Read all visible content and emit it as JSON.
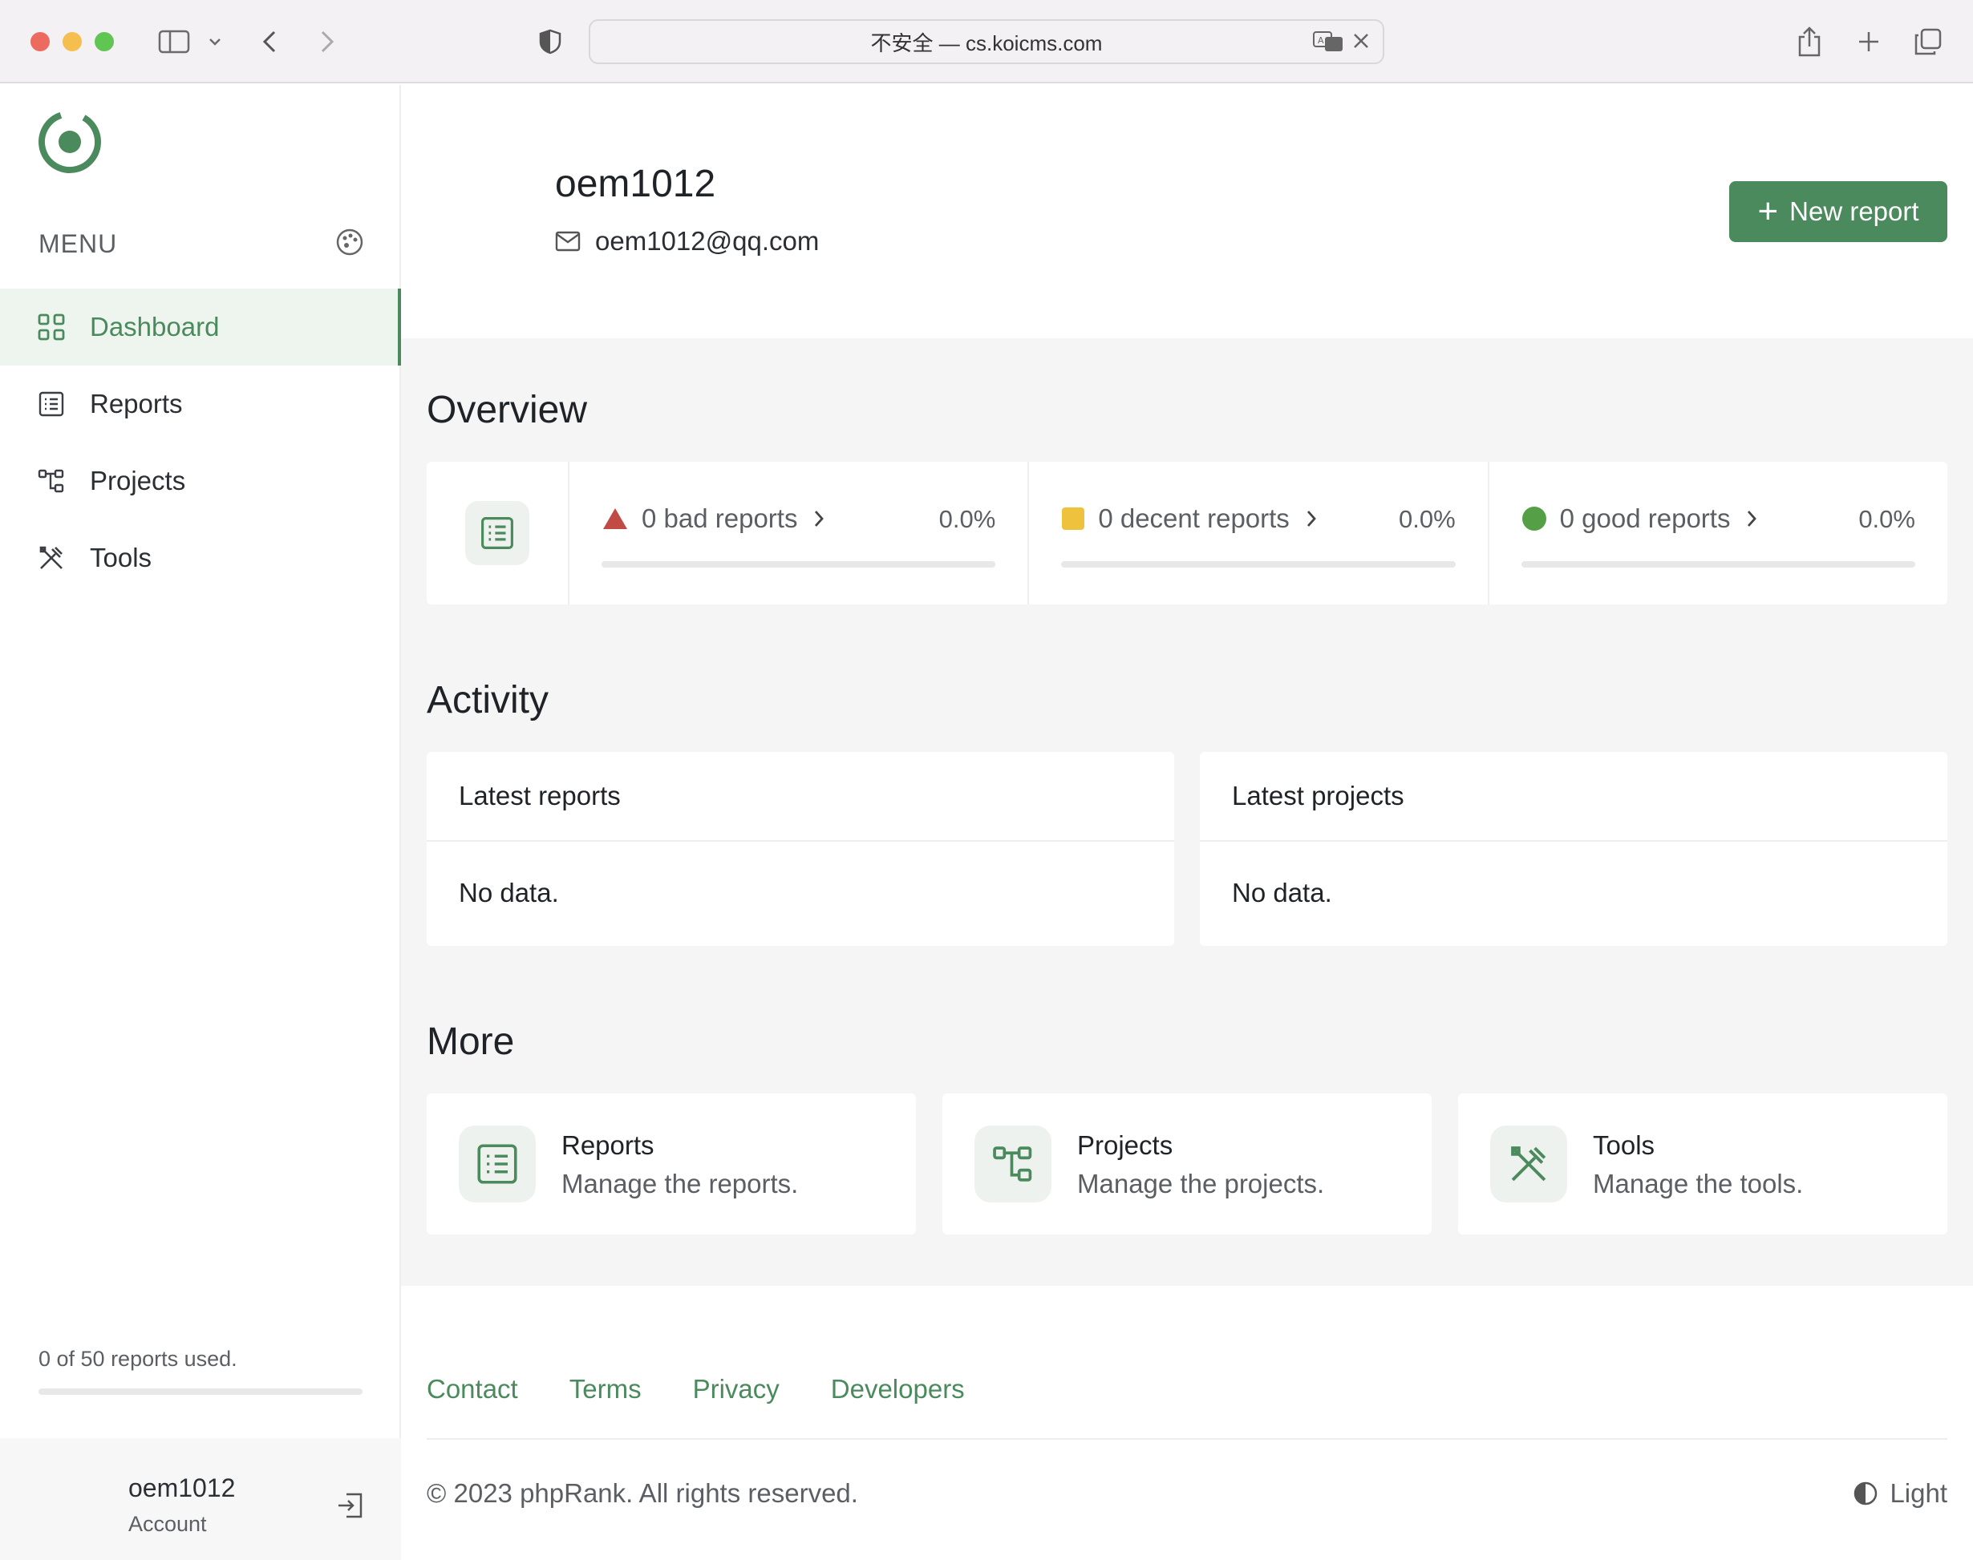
{
  "browser": {
    "url_text": "不安全 — cs.koicms.com"
  },
  "sidebar": {
    "menu_label": "MENU",
    "items": [
      {
        "label": "Dashboard",
        "icon": "dashboard-grid-icon",
        "active": true
      },
      {
        "label": "Reports",
        "icon": "reports-list-icon",
        "active": false
      },
      {
        "label": "Projects",
        "icon": "projects-flow-icon",
        "active": false
      },
      {
        "label": "Tools",
        "icon": "tools-icon",
        "active": false
      }
    ],
    "usage_text": "0 of 50 reports used.",
    "usage_fraction": 0,
    "account": {
      "name": "oem1012",
      "subtitle": "Account"
    }
  },
  "header": {
    "username": "oem1012",
    "email": "oem1012@qq.com",
    "new_report_label": "New report"
  },
  "overview": {
    "title": "Overview",
    "cells": [
      {
        "label": "0 bad reports",
        "percent": "0.0%",
        "marker": "triangle",
        "color": "#c24a45",
        "fraction": 0
      },
      {
        "label": "0 decent reports",
        "percent": "0.0%",
        "marker": "square",
        "color": "#efc23e",
        "fraction": 0
      },
      {
        "label": "0 good reports",
        "percent": "0.0%",
        "marker": "circle",
        "color": "#55a046",
        "fraction": 0
      }
    ]
  },
  "activity": {
    "title": "Activity",
    "latest_reports": {
      "title": "Latest reports",
      "empty": "No data."
    },
    "latest_projects": {
      "title": "Latest projects",
      "empty": "No data."
    }
  },
  "more": {
    "title": "More",
    "cards": [
      {
        "title": "Reports",
        "desc": "Manage the reports.",
        "icon": "reports-list-icon"
      },
      {
        "title": "Projects",
        "desc": "Manage the projects.",
        "icon": "projects-flow-icon"
      },
      {
        "title": "Tools",
        "desc": "Manage the tools.",
        "icon": "tools-icon"
      }
    ]
  },
  "footer": {
    "links": [
      "Contact",
      "Terms",
      "Privacy",
      "Developers"
    ],
    "copyright": "© 2023 phpRank. All rights reserved.",
    "theme_label": "Light"
  },
  "colors": {
    "accent": "#4a8a5c",
    "accent_bg": "#eef5ef"
  }
}
